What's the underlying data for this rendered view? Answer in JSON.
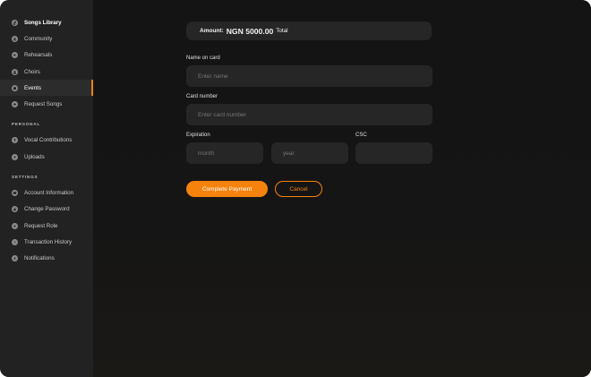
{
  "sidebar": {
    "top_items": [
      {
        "label": "Songs Library",
        "icon": "music-note-icon"
      },
      {
        "label": "Community",
        "icon": "community-icon"
      },
      {
        "label": "Rehearsals",
        "icon": "rehearsal-icon"
      },
      {
        "label": "Choirs",
        "icon": "choir-icon"
      },
      {
        "label": "Events",
        "icon": "calendar-icon"
      },
      {
        "label": "Request Songs",
        "icon": "request-icon"
      }
    ],
    "personal_title": "PERSONAL",
    "personal_items": [
      {
        "label": "Vocal Contributions",
        "icon": "microphone-icon"
      },
      {
        "label": "Uploads",
        "icon": "upload-icon"
      }
    ],
    "settings_title": "SETTINGS",
    "settings_items": [
      {
        "label": "Account Information",
        "icon": "user-card-icon"
      },
      {
        "label": "Change Password",
        "icon": "lock-icon"
      },
      {
        "label": "Request Role",
        "icon": "role-icon"
      },
      {
        "label": "Transaction History",
        "icon": "history-icon"
      },
      {
        "label": "Notifications",
        "icon": "bell-icon"
      }
    ],
    "active_item": "Events"
  },
  "payment": {
    "amount_label": "Amount:",
    "amount_value": "NGN 5000.00",
    "amount_suffix": "Total",
    "name_label": "Name on card",
    "name_placeholder": "Enter name",
    "card_label": "Card number",
    "card_placeholder": "Enter card number",
    "expiration_label": "Expiration",
    "month_placeholder": "month",
    "year_placeholder": "year",
    "csc_label": "CSC",
    "csc_placeholder": "",
    "pay_button": "Complete Payment",
    "cancel_button": "Cancel"
  },
  "colors": {
    "accent": "#f5820d",
    "sidebar_bg": "#222222",
    "main_bg": "#141414",
    "field_bg": "#262626"
  }
}
